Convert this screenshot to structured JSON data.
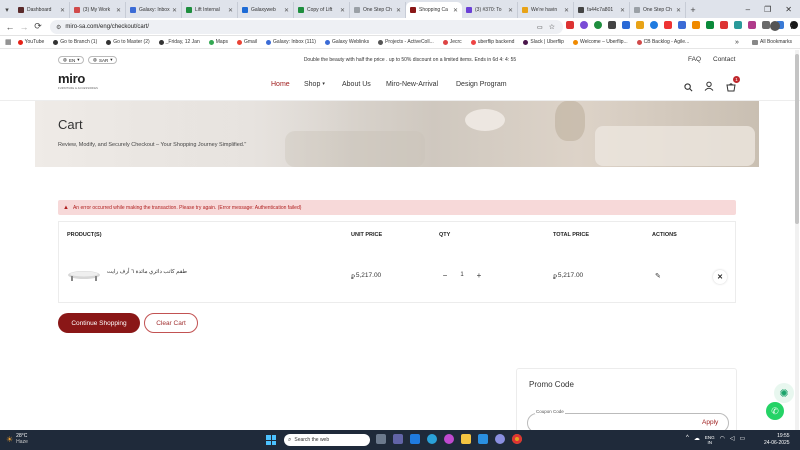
{
  "browser": {
    "tabs": [
      {
        "label": "Dashboard",
        "color": "#5a2a2a"
      },
      {
        "label": "(3) My Work",
        "color": "#d14a4a"
      },
      {
        "label": "Galaxy: Inbox",
        "color": "#3b6bd6"
      },
      {
        "label": "Lift Internal",
        "color": "#1e8e3e"
      },
      {
        "label": "Galaxyweb",
        "color": "#1d6bd6"
      },
      {
        "label": "Copy of Lift",
        "color": "#1e8e3e"
      },
      {
        "label": "One Step Ch",
        "color": "#9aa0a6"
      },
      {
        "label": "Shopping Ca",
        "color": "#8a1717",
        "active": true
      },
      {
        "label": "(3) #370: To",
        "color": "#6a3fd6"
      },
      {
        "label": "We're havin",
        "color": "#e8a317"
      },
      {
        "label": "fa44c7a801",
        "color": "#444"
      },
      {
        "label": "One Step Ch",
        "color": "#9aa0a6"
      }
    ],
    "url": "miro-sa.com/eng/checkout/cart/",
    "bookmarks": [
      {
        "label": "YouTube",
        "color": "#e62117"
      },
      {
        "label": "Go to Branch (1)",
        "color": "#333"
      },
      {
        "label": "Go to Master (2)",
        "color": "#333"
      },
      {
        "label": "_Friday, 12 Jan",
        "color": "#333"
      },
      {
        "label": "Maps",
        "color": "#34a853"
      },
      {
        "label": "Gmail",
        "color": "#ea4335"
      },
      {
        "label": "Galaxy: Inbox (111)",
        "color": "#3b6bd6"
      },
      {
        "label": "Galaxy Weblinks",
        "color": "#3b6bd6"
      },
      {
        "label": "Projects - ActiveColl...",
        "color": "#555"
      },
      {
        "label": "Jecrc",
        "color": "#d44"
      },
      {
        "label": "uberflip backend",
        "color": "#e44"
      },
      {
        "label": "Slack | Uberflip",
        "color": "#4a154b"
      },
      {
        "label": "Welcome – Uberflip...",
        "color": "#f08a00"
      },
      {
        "label": "CB Backlog - Agile...",
        "color": "#d14a4a"
      }
    ],
    "all_bookmarks": "All Bookmarks"
  },
  "site": {
    "logo": "miro",
    "logo_tagline": "FURNITURE & ACCESSORIES",
    "language": "EN",
    "currency": "SAR",
    "promo_banner": "Double the beauty with half the price . up to 50% discount on a limited items. Ends in 6d 4: 4: 55",
    "top_links": [
      "FAQ",
      "Contact"
    ],
    "menu": [
      "Home",
      "Shop",
      "About Us",
      "Miro-New-Arrival",
      "Design Program"
    ],
    "cart_count": "1",
    "hero_title": "Cart",
    "hero_subtitle": "Review, Modify, and Securely Checkout – Your Shopping Journey Simplified.\"",
    "error_message": "An error occurred while making the transaction. Please try again. (Error message: Authentication failed)",
    "table_headers": [
      "PRODUCT(S)",
      "UNIT PRICE",
      "QTY",
      "TOTAL PRICE",
      "ACTIONS"
    ],
    "item": {
      "name": "طقم كاتب دائري مائدة ٦ أرف رايت",
      "unit_price": "5,217.00",
      "qty": "1",
      "total": "5,217.00",
      "currency_symbol": "⃁"
    },
    "continue_label": "Continue Shopping",
    "clear_label": "Clear Cart",
    "promo_title": "Promo Code",
    "coupon_label": "Coupon Code",
    "apply_label": "Apply"
  },
  "taskbar": {
    "weather_temp": "28°C",
    "weather_desc": "Haze",
    "search_placeholder": "Search the web",
    "lang": "ENG",
    "region": "IN",
    "time": "19:55",
    "date": "24-06-2025"
  }
}
